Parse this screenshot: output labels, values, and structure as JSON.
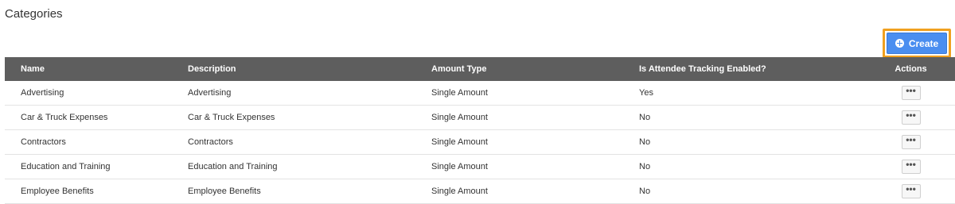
{
  "page": {
    "title": "Categories"
  },
  "toolbar": {
    "create_label": "Create",
    "create_icon": "plus-circle-icon"
  },
  "table": {
    "columns": {
      "name": "Name",
      "description": "Description",
      "amount_type": "Amount Type",
      "tracking": "Is Attendee Tracking Enabled?",
      "actions": "Actions"
    },
    "rows": [
      {
        "name": "Advertising",
        "description": "Advertising",
        "amount_type": "Single Amount",
        "tracking": "Yes",
        "actions_label": "•••"
      },
      {
        "name": "Car & Truck Expenses",
        "description": "Car & Truck Expenses",
        "amount_type": "Single Amount",
        "tracking": "No",
        "actions_label": "•••"
      },
      {
        "name": "Contractors",
        "description": "Contractors",
        "amount_type": "Single Amount",
        "tracking": "No",
        "actions_label": "•••"
      },
      {
        "name": "Education and Training",
        "description": "Education and Training",
        "amount_type": "Single Amount",
        "tracking": "No",
        "actions_label": "•••"
      },
      {
        "name": "Employee Benefits",
        "description": "Employee Benefits",
        "amount_type": "Single Amount",
        "tracking": "No",
        "actions_label": "•••"
      }
    ]
  },
  "colors": {
    "header_bg": "#5e5e5e",
    "primary_button": "#4a8ef0",
    "highlight_outline": "#f0a020"
  }
}
